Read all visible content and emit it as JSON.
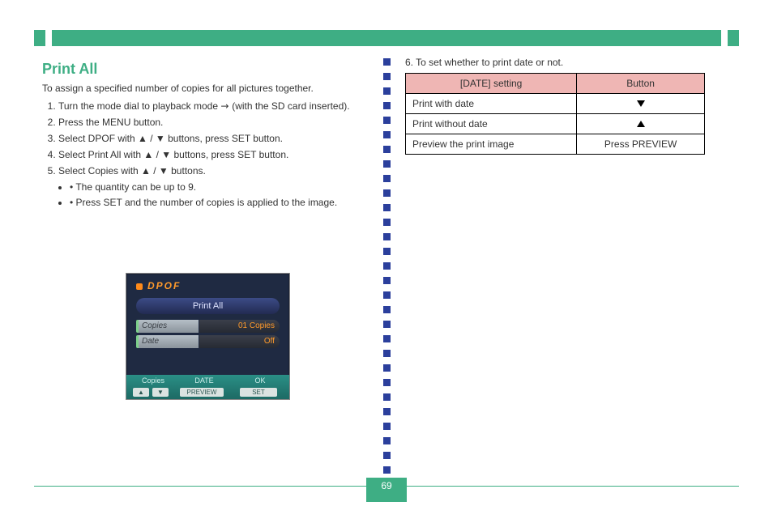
{
  "topbar": {
    "title": ""
  },
  "left": {
    "section_title": "Print All",
    "intro": "To assign a specified number of copies for all pictures together.",
    "steps": [
      "Turn the mode dial to playback mode",
      "(with the SD card inserted).",
      "Press the MENU button.",
      "Select DPOF with ▲ / ▼ buttons, press SET button.",
      "Select Print All with ▲ / ▼ buttons, press SET button.",
      "Select Copies with ▲ / ▼ buttons.",
      "• The quantity can be up to 9.",
      "• Press SET and the number of copies is applied to the image."
    ]
  },
  "shot": {
    "brand": "DPOF",
    "pill": "Print All",
    "rows": [
      {
        "label": "Copies",
        "value": "01 Copies"
      },
      {
        "label": "Date",
        "value": "Off"
      }
    ],
    "footer": {
      "cols": [
        "Copies",
        "DATE",
        "OK"
      ],
      "btns": [
        "▲",
        "▼",
        "PREVIEW",
        "SET"
      ]
    }
  },
  "right": {
    "lead": "To set whether to print date or not.",
    "table": {
      "head": [
        "[DATE] setting",
        "Button"
      ],
      "rows": [
        [
          "Print with date",
          "▼"
        ],
        [
          "Print without date",
          "▲"
        ],
        [
          "Preview the print image",
          "Press PREVIEW"
        ]
      ]
    }
  },
  "page_number": "69"
}
